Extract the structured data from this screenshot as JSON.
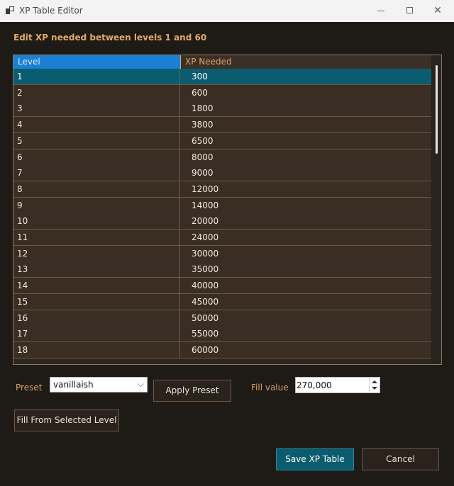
{
  "window": {
    "title": "XP Table Editor"
  },
  "heading": "Edit XP needed between levels 1 and 60",
  "grid": {
    "columns": [
      "Level",
      "XP Needed"
    ],
    "rows": [
      [
        "1",
        "300"
      ],
      [
        "2",
        "600"
      ],
      [
        "3",
        "1800"
      ],
      [
        "4",
        "3800"
      ],
      [
        "5",
        "6500"
      ],
      [
        "6",
        "8000"
      ],
      [
        "7",
        "9000"
      ],
      [
        "8",
        "12000"
      ],
      [
        "9",
        "14000"
      ],
      [
        "10",
        "20000"
      ],
      [
        "11",
        "24000"
      ],
      [
        "12",
        "30000"
      ],
      [
        "13",
        "35000"
      ],
      [
        "14",
        "40000"
      ],
      [
        "15",
        "45000"
      ],
      [
        "16",
        "50000"
      ],
      [
        "17",
        "55000"
      ],
      [
        "18",
        "60000"
      ]
    ],
    "selected_row": 1
  },
  "preset": {
    "label": "Preset",
    "value": "vanillaish"
  },
  "buttons": {
    "apply": "Apply Preset",
    "fill_from_selected": "Fill From Selected Level",
    "save": "Save XP Table",
    "cancel": "Cancel"
  },
  "fill": {
    "label": "Fill value",
    "value": "270,000"
  },
  "colors": {
    "accent": "#0b5c6e",
    "header_selected": "#1a80d6",
    "label": "#d9a262"
  }
}
